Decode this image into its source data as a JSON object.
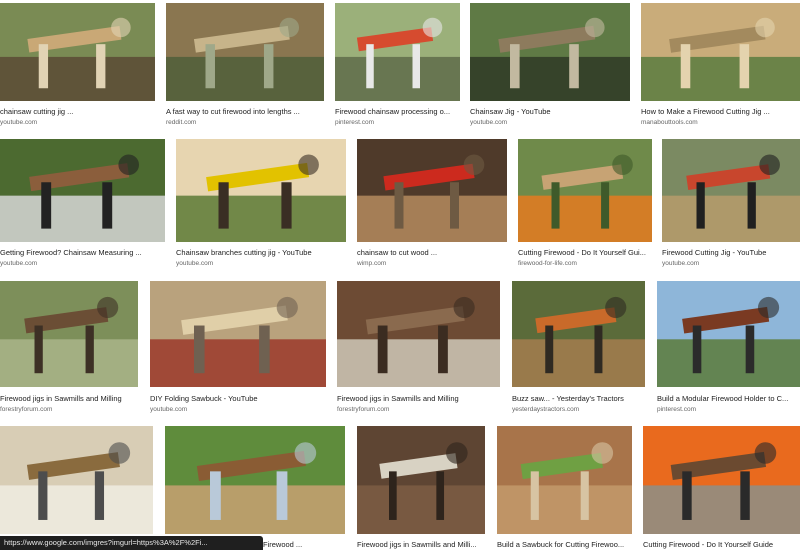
{
  "results": [
    {
      "title": "chainsaw cutting jig ...",
      "source": "youtube.com",
      "palette": [
        "#7a8b54",
        "#c9a876",
        "#5b4a35",
        "#e1d3b4"
      ]
    },
    {
      "title": "A fast way to cut firewood into lengths ...",
      "source": "reddit.com",
      "palette": [
        "#8a7650",
        "#c7b48a",
        "#4f5f3a",
        "#9fa889"
      ]
    },
    {
      "title": "Firewood chainsaw processing o...",
      "source": "pinterest.com",
      "palette": [
        "#9bb07a",
        "#d64b2f",
        "#5f6c4a",
        "#e8e8e8"
      ]
    },
    {
      "title": "Chainsaw Jig - YouTube",
      "source": "youtube.com",
      "palette": [
        "#5f7a45",
        "#8d7b5d",
        "#2f3a26",
        "#c2b9a0"
      ]
    },
    {
      "title": "How to Make a Firewood Cutting Jig ...",
      "source": "manabouttools.com",
      "palette": [
        "#c9ac7a",
        "#a38a5e",
        "#5b7b3f",
        "#e4d3ae"
      ]
    },
    {
      "title": "Getting Firewood? Chainsaw Measuring ...",
      "source": "youtube.com",
      "palette": [
        "#4c6a30",
        "#8b5e3c",
        "#d7d7d7",
        "#222222"
      ]
    },
    {
      "title": "Chainsaw branches cutting jig - YouTube",
      "source": "youtube.com",
      "palette": [
        "#e7d5b0",
        "#e2c200",
        "#5c7a36",
        "#3a2e24"
      ]
    },
    {
      "title": "chainsaw to cut wood ...",
      "source": "wimp.com",
      "palette": [
        "#4f3a2a",
        "#cc2a1e",
        "#b48b5e",
        "#6e5a43"
      ]
    },
    {
      "title": "Cutting Firewood - Do It Yourself Gui...",
      "source": "firewood-for-life.com",
      "palette": [
        "#6f8a4a",
        "#c7a374",
        "#e57a20",
        "#3f5a2a"
      ]
    },
    {
      "title": "Firewood Cutting Jig - YouTube",
      "source": "youtube.com",
      "palette": [
        "#7b8a62",
        "#c8462d",
        "#b79b6c",
        "#202020"
      ]
    },
    {
      "title": "Firewood jigs in Sawmills and Milling",
      "source": "forestryforum.com",
      "palette": [
        "#7d8f5a",
        "#6b4e35",
        "#a9b58a",
        "#3d3025"
      ]
    },
    {
      "title": "DIY Folding Sawbuck - YouTube",
      "source": "youtube.com",
      "palette": [
        "#b9a27d",
        "#e0cfa8",
        "#9b3a2a",
        "#6f6151"
      ]
    },
    {
      "title": "Firewood jigs in Sawmills and Milling",
      "source": "forestryforum.com",
      "palette": [
        "#6d4b34",
        "#8a6a4e",
        "#cfc8b8",
        "#3b2c21"
      ]
    },
    {
      "title": "Buzz saw... - Yesterday's Tractors",
      "source": "yesterdaystractors.com",
      "palette": [
        "#5b6b3a",
        "#c96a2a",
        "#a57d4f",
        "#2f2a22"
      ]
    },
    {
      "title": "Build a Modular Firewood Holder to C...",
      "source": "pinterest.com",
      "palette": [
        "#8eb6d9",
        "#7a3a22",
        "#5c7b3a",
        "#2b2b2b"
      ]
    },
    {
      "title": "",
      "source": "",
      "palette": [
        "#d8cdb5",
        "#8a6b3e",
        "#f0ece2",
        "#4d4d4d"
      ]
    },
    {
      "title": "Firewood ...",
      "source": "",
      "palette": [
        "#5f8c3c",
        "#8a5c34",
        "#c8a172",
        "#b9c9d9"
      ]
    },
    {
      "title": "Firewood jigs in Sawmills and Milli...",
      "source": "",
      "palette": [
        "#5e4533",
        "#d8d2c3",
        "#7c5d44",
        "#2e241c"
      ]
    },
    {
      "title": "Build a Sawbuck for Cutting Firewoo...",
      "source": "",
      "palette": [
        "#a8744a",
        "#6fa043",
        "#c39a6b",
        "#d7c4a3"
      ]
    },
    {
      "title": "Cutting Firewood - Do It Yourself Guide",
      "source": "",
      "palette": [
        "#e96a1e",
        "#6b4a30",
        "#8c8f88",
        "#2a2a2a"
      ]
    }
  ],
  "status_url": "https://www.google.com/imgres?imgurl=https%3A%2F%2Fi..."
}
